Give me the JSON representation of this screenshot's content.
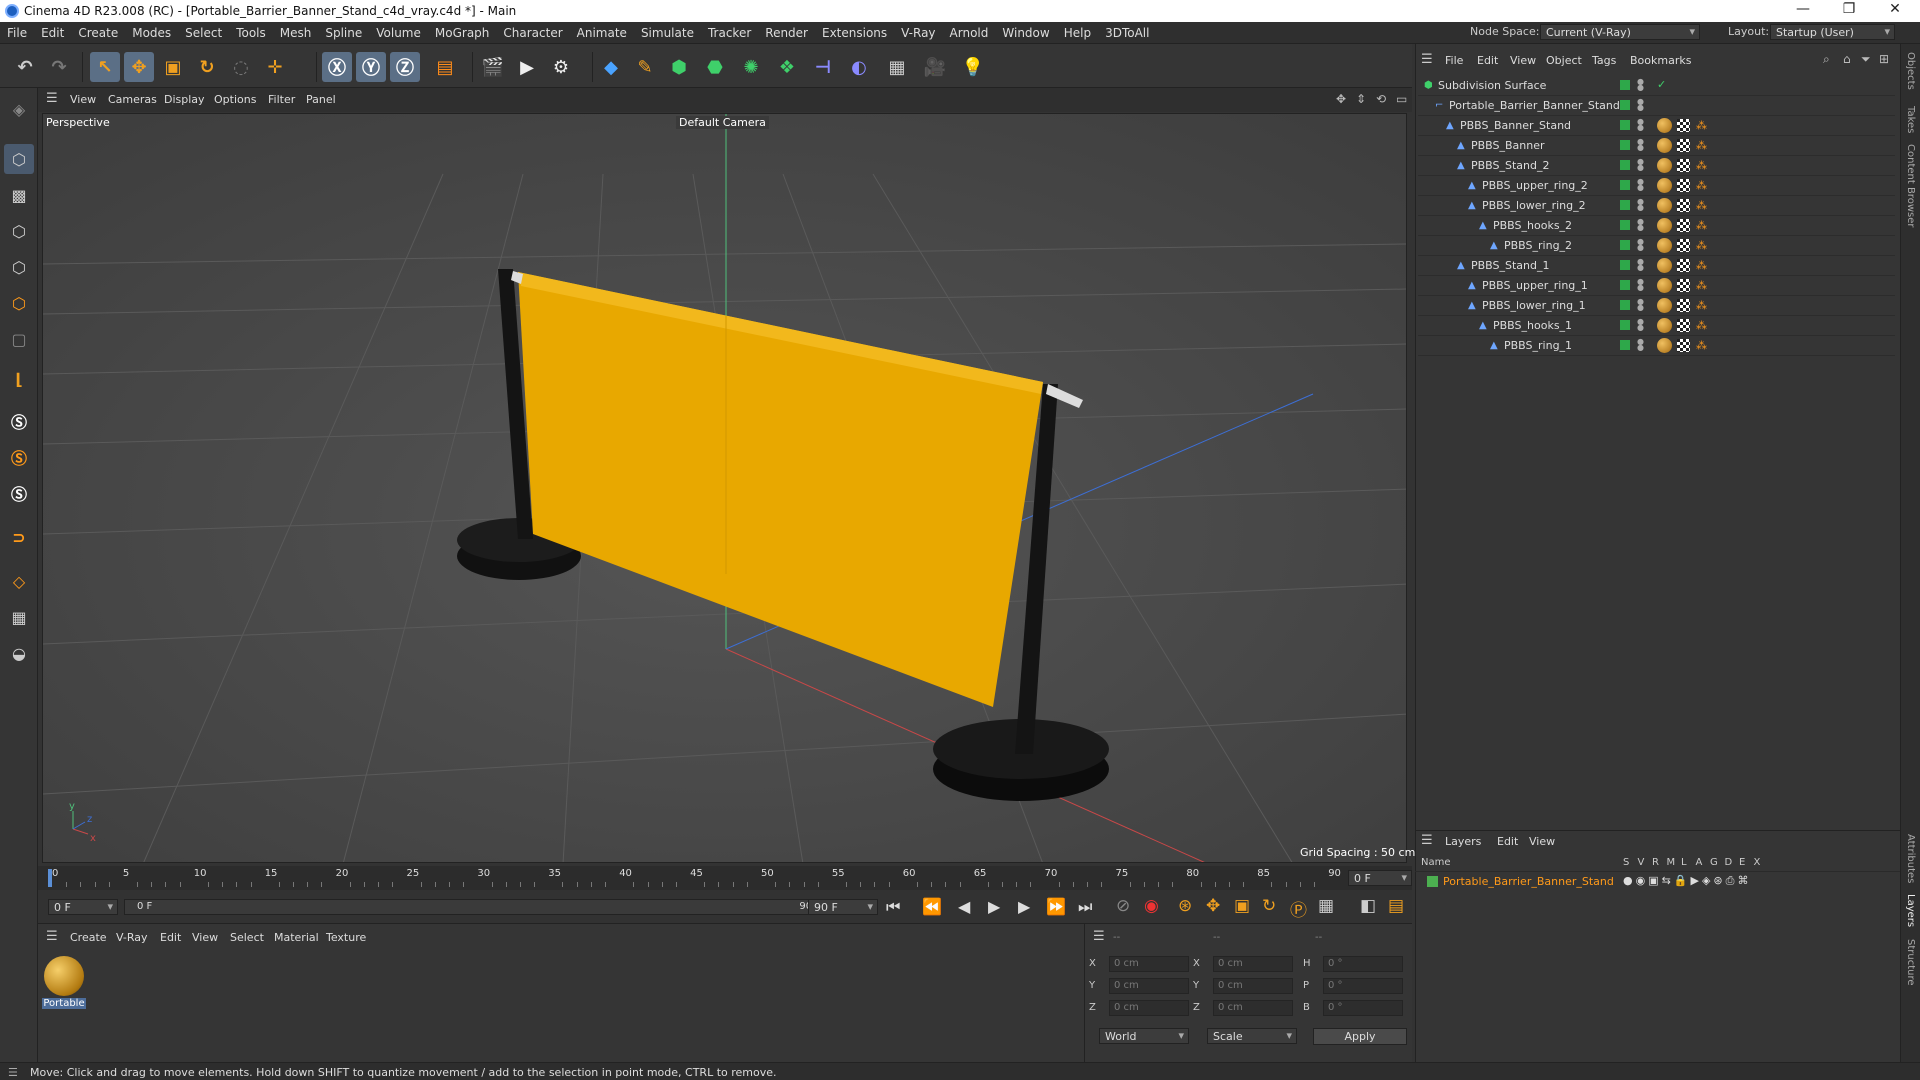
{
  "window": {
    "title": "Cinema 4D R23.008 (RC) - [Portable_Barrier_Banner_Stand_c4d_vray.c4d *] - Main",
    "controls": [
      "—",
      "❐",
      "✕"
    ]
  },
  "menubar": {
    "items": [
      "File",
      "Edit",
      "Create",
      "Modes",
      "Select",
      "Tools",
      "Mesh",
      "Spline",
      "Volume",
      "MoGraph",
      "Character",
      "Animate",
      "Simulate",
      "Tracker",
      "Render",
      "Extensions",
      "V-Ray",
      "Arnold",
      "Window",
      "Help",
      "3DToAll"
    ],
    "node_space_label": "Node Space:",
    "node_space_value": "Current (V-Ray)",
    "layout_label": "Layout:",
    "layout_value": "Startup (User)"
  },
  "viewport": {
    "menu": [
      "View",
      "Cameras",
      "Display",
      "Options",
      "Filter",
      "Panel"
    ],
    "label": "Perspective",
    "camera": "Default Camera",
    "grid_spacing": "Grid Spacing : 50 cm",
    "banner_color": "#e8a800"
  },
  "timeline": {
    "ticks": [
      "0",
      "5",
      "10",
      "15",
      "20",
      "25",
      "30",
      "35",
      "40",
      "45",
      "50",
      "55",
      "60",
      "65",
      "70",
      "75",
      "80",
      "85",
      "90"
    ],
    "current_frame": "0 F",
    "start": "0 F",
    "range_start": "0 F",
    "range_end": "90 F",
    "end": "90 F"
  },
  "material_manager": {
    "menu": [
      "Create",
      "V-Ray",
      "Edit",
      "View",
      "Select",
      "Material",
      "Texture"
    ],
    "material_name": "Portable"
  },
  "coordinates": {
    "headers": [
      "--",
      "--",
      "--"
    ],
    "rows": [
      {
        "a": "X",
        "av": "0 cm",
        "b": "X",
        "bv": "0 cm",
        "c": "H",
        "cv": "0 °"
      },
      {
        "a": "Y",
        "av": "0 cm",
        "b": "Y",
        "bv": "0 cm",
        "c": "P",
        "cv": "0 °"
      },
      {
        "a": "Z",
        "av": "0 cm",
        "b": "Z",
        "bv": "0 cm",
        "c": "B",
        "cv": "0 °"
      }
    ],
    "space": "World",
    "mode": "Scale",
    "apply": "Apply"
  },
  "object_manager": {
    "menu": [
      "File",
      "Edit",
      "View",
      "Object",
      "Tags",
      "Bookmarks"
    ],
    "objects": [
      {
        "name": "Subdivision Surface",
        "depth": 0
      },
      {
        "name": "Portable_Barrier_Banner_Stand",
        "depth": 1
      },
      {
        "name": "PBBS_Banner_Stand",
        "depth": 2
      },
      {
        "name": "PBBS_Banner",
        "depth": 3
      },
      {
        "name": "PBBS_Stand_2",
        "depth": 3
      },
      {
        "name": "PBBS_upper_ring_2",
        "depth": 4
      },
      {
        "name": "PBBS_lower_ring_2",
        "depth": 4
      },
      {
        "name": "PBBS_hooks_2",
        "depth": 5
      },
      {
        "name": "PBBS_ring_2",
        "depth": 6
      },
      {
        "name": "PBBS_Stand_1",
        "depth": 3
      },
      {
        "name": "PBBS_upper_ring_1",
        "depth": 4
      },
      {
        "name": "PBBS_lower_ring_1",
        "depth": 4
      },
      {
        "name": "PBBS_hooks_1",
        "depth": 5
      },
      {
        "name": "PBBS_ring_1",
        "depth": 6
      }
    ]
  },
  "layers": {
    "menu": [
      "Layers",
      "Edit",
      "View"
    ],
    "name_header": "Name",
    "flag_headers": [
      "S",
      "V",
      "R",
      "M",
      "L",
      "A",
      "G",
      "D",
      "E",
      "X"
    ],
    "layer_name": "Portable_Barrier_Banner_Stand",
    "layer_color": "#4caf50"
  },
  "side_tabs": [
    "Objects",
    "Takes",
    "Content Browser",
    "Attributes",
    "Layers",
    "Structure"
  ],
  "status": "Move: Click and drag to move elements. Hold down SHIFT to quantize movement / add to the selection in point mode, CTRL to remove."
}
